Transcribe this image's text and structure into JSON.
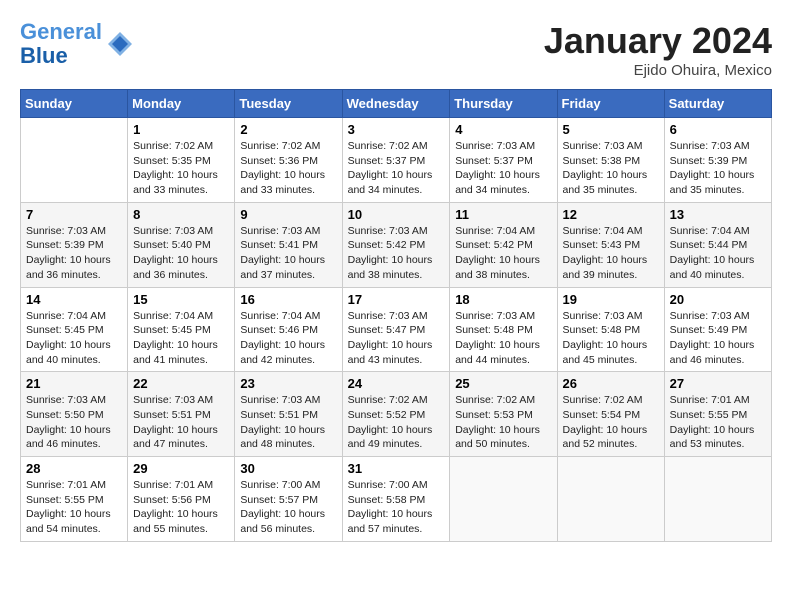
{
  "header": {
    "logo_line1": "General",
    "logo_line2": "Blue",
    "month": "January 2024",
    "location": "Ejido Ohuira, Mexico"
  },
  "weekdays": [
    "Sunday",
    "Monday",
    "Tuesday",
    "Wednesday",
    "Thursday",
    "Friday",
    "Saturday"
  ],
  "weeks": [
    [
      {
        "day": "",
        "sunrise": "",
        "sunset": "",
        "daylight": ""
      },
      {
        "day": "1",
        "sunrise": "Sunrise: 7:02 AM",
        "sunset": "Sunset: 5:35 PM",
        "daylight": "Daylight: 10 hours and 33 minutes."
      },
      {
        "day": "2",
        "sunrise": "Sunrise: 7:02 AM",
        "sunset": "Sunset: 5:36 PM",
        "daylight": "Daylight: 10 hours and 33 minutes."
      },
      {
        "day": "3",
        "sunrise": "Sunrise: 7:02 AM",
        "sunset": "Sunset: 5:37 PM",
        "daylight": "Daylight: 10 hours and 34 minutes."
      },
      {
        "day": "4",
        "sunrise": "Sunrise: 7:03 AM",
        "sunset": "Sunset: 5:37 PM",
        "daylight": "Daylight: 10 hours and 34 minutes."
      },
      {
        "day": "5",
        "sunrise": "Sunrise: 7:03 AM",
        "sunset": "Sunset: 5:38 PM",
        "daylight": "Daylight: 10 hours and 35 minutes."
      },
      {
        "day": "6",
        "sunrise": "Sunrise: 7:03 AM",
        "sunset": "Sunset: 5:39 PM",
        "daylight": "Daylight: 10 hours and 35 minutes."
      }
    ],
    [
      {
        "day": "7",
        "sunrise": "Sunrise: 7:03 AM",
        "sunset": "Sunset: 5:39 PM",
        "daylight": "Daylight: 10 hours and 36 minutes."
      },
      {
        "day": "8",
        "sunrise": "Sunrise: 7:03 AM",
        "sunset": "Sunset: 5:40 PM",
        "daylight": "Daylight: 10 hours and 36 minutes."
      },
      {
        "day": "9",
        "sunrise": "Sunrise: 7:03 AM",
        "sunset": "Sunset: 5:41 PM",
        "daylight": "Daylight: 10 hours and 37 minutes."
      },
      {
        "day": "10",
        "sunrise": "Sunrise: 7:03 AM",
        "sunset": "Sunset: 5:42 PM",
        "daylight": "Daylight: 10 hours and 38 minutes."
      },
      {
        "day": "11",
        "sunrise": "Sunrise: 7:04 AM",
        "sunset": "Sunset: 5:42 PM",
        "daylight": "Daylight: 10 hours and 38 minutes."
      },
      {
        "day": "12",
        "sunrise": "Sunrise: 7:04 AM",
        "sunset": "Sunset: 5:43 PM",
        "daylight": "Daylight: 10 hours and 39 minutes."
      },
      {
        "day": "13",
        "sunrise": "Sunrise: 7:04 AM",
        "sunset": "Sunset: 5:44 PM",
        "daylight": "Daylight: 10 hours and 40 minutes."
      }
    ],
    [
      {
        "day": "14",
        "sunrise": "Sunrise: 7:04 AM",
        "sunset": "Sunset: 5:45 PM",
        "daylight": "Daylight: 10 hours and 40 minutes."
      },
      {
        "day": "15",
        "sunrise": "Sunrise: 7:04 AM",
        "sunset": "Sunset: 5:45 PM",
        "daylight": "Daylight: 10 hours and 41 minutes."
      },
      {
        "day": "16",
        "sunrise": "Sunrise: 7:04 AM",
        "sunset": "Sunset: 5:46 PM",
        "daylight": "Daylight: 10 hours and 42 minutes."
      },
      {
        "day": "17",
        "sunrise": "Sunrise: 7:03 AM",
        "sunset": "Sunset: 5:47 PM",
        "daylight": "Daylight: 10 hours and 43 minutes."
      },
      {
        "day": "18",
        "sunrise": "Sunrise: 7:03 AM",
        "sunset": "Sunset: 5:48 PM",
        "daylight": "Daylight: 10 hours and 44 minutes."
      },
      {
        "day": "19",
        "sunrise": "Sunrise: 7:03 AM",
        "sunset": "Sunset: 5:48 PM",
        "daylight": "Daylight: 10 hours and 45 minutes."
      },
      {
        "day": "20",
        "sunrise": "Sunrise: 7:03 AM",
        "sunset": "Sunset: 5:49 PM",
        "daylight": "Daylight: 10 hours and 46 minutes."
      }
    ],
    [
      {
        "day": "21",
        "sunrise": "Sunrise: 7:03 AM",
        "sunset": "Sunset: 5:50 PM",
        "daylight": "Daylight: 10 hours and 46 minutes."
      },
      {
        "day": "22",
        "sunrise": "Sunrise: 7:03 AM",
        "sunset": "Sunset: 5:51 PM",
        "daylight": "Daylight: 10 hours and 47 minutes."
      },
      {
        "day": "23",
        "sunrise": "Sunrise: 7:03 AM",
        "sunset": "Sunset: 5:51 PM",
        "daylight": "Daylight: 10 hours and 48 minutes."
      },
      {
        "day": "24",
        "sunrise": "Sunrise: 7:02 AM",
        "sunset": "Sunset: 5:52 PM",
        "daylight": "Daylight: 10 hours and 49 minutes."
      },
      {
        "day": "25",
        "sunrise": "Sunrise: 7:02 AM",
        "sunset": "Sunset: 5:53 PM",
        "daylight": "Daylight: 10 hours and 50 minutes."
      },
      {
        "day": "26",
        "sunrise": "Sunrise: 7:02 AM",
        "sunset": "Sunset: 5:54 PM",
        "daylight": "Daylight: 10 hours and 52 minutes."
      },
      {
        "day": "27",
        "sunrise": "Sunrise: 7:01 AM",
        "sunset": "Sunset: 5:55 PM",
        "daylight": "Daylight: 10 hours and 53 minutes."
      }
    ],
    [
      {
        "day": "28",
        "sunrise": "Sunrise: 7:01 AM",
        "sunset": "Sunset: 5:55 PM",
        "daylight": "Daylight: 10 hours and 54 minutes."
      },
      {
        "day": "29",
        "sunrise": "Sunrise: 7:01 AM",
        "sunset": "Sunset: 5:56 PM",
        "daylight": "Daylight: 10 hours and 55 minutes."
      },
      {
        "day": "30",
        "sunrise": "Sunrise: 7:00 AM",
        "sunset": "Sunset: 5:57 PM",
        "daylight": "Daylight: 10 hours and 56 minutes."
      },
      {
        "day": "31",
        "sunrise": "Sunrise: 7:00 AM",
        "sunset": "Sunset: 5:58 PM",
        "daylight": "Daylight: 10 hours and 57 minutes."
      },
      {
        "day": "",
        "sunrise": "",
        "sunset": "",
        "daylight": ""
      },
      {
        "day": "",
        "sunrise": "",
        "sunset": "",
        "daylight": ""
      },
      {
        "day": "",
        "sunrise": "",
        "sunset": "",
        "daylight": ""
      }
    ]
  ]
}
